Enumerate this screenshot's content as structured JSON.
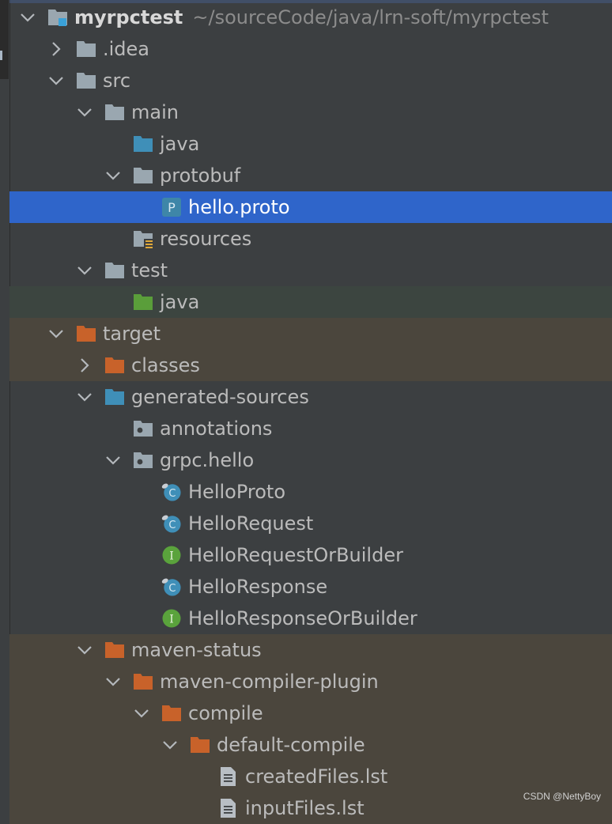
{
  "tree": [
    {
      "label": "myrpctest",
      "hint": "~/sourceCode/java/lrn-soft/myrpctest",
      "depth": 0,
      "arrow": "down",
      "icon": "module-folder-icon",
      "bold": true
    },
    {
      "label": ".idea",
      "depth": 1,
      "arrow": "right",
      "icon": "folder-icon"
    },
    {
      "label": "src",
      "depth": 1,
      "arrow": "down",
      "icon": "folder-icon"
    },
    {
      "label": "main",
      "depth": 2,
      "arrow": "down",
      "icon": "folder-icon"
    },
    {
      "label": "java",
      "depth": 3,
      "arrow": "none",
      "icon": "source-folder-icon"
    },
    {
      "label": "protobuf",
      "depth": 3,
      "arrow": "down",
      "icon": "folder-icon"
    },
    {
      "label": "hello.proto",
      "depth": 4,
      "arrow": "none",
      "icon": "proto-file-icon",
      "selected": true
    },
    {
      "label": "resources",
      "depth": 3,
      "arrow": "none",
      "icon": "resources-folder-icon"
    },
    {
      "label": "test",
      "depth": 2,
      "arrow": "down",
      "icon": "folder-icon"
    },
    {
      "label": "java",
      "depth": 3,
      "arrow": "none",
      "icon": "test-folder-icon",
      "bg": "grn"
    },
    {
      "label": "target",
      "depth": 1,
      "arrow": "down",
      "icon": "excluded-folder-icon",
      "bg": "brn"
    },
    {
      "label": "classes",
      "depth": 2,
      "arrow": "right",
      "icon": "excluded-folder-icon",
      "bg": "brn"
    },
    {
      "label": "generated-sources",
      "depth": 2,
      "arrow": "down",
      "icon": "generated-folder-icon"
    },
    {
      "label": "annotations",
      "depth": 3,
      "arrow": "none",
      "icon": "package-icon"
    },
    {
      "label": "grpc.hello",
      "depth": 3,
      "arrow": "down",
      "icon": "package-icon"
    },
    {
      "label": "HelloProto",
      "depth": 4,
      "arrow": "none",
      "icon": "class-icon"
    },
    {
      "label": "HelloRequest",
      "depth": 4,
      "arrow": "none",
      "icon": "class-icon"
    },
    {
      "label": "HelloRequestOrBuilder",
      "depth": 4,
      "arrow": "none",
      "icon": "interface-icon"
    },
    {
      "label": "HelloResponse",
      "depth": 4,
      "arrow": "none",
      "icon": "class-icon"
    },
    {
      "label": "HelloResponseOrBuilder",
      "depth": 4,
      "arrow": "none",
      "icon": "interface-icon"
    },
    {
      "label": "maven-status",
      "depth": 2,
      "arrow": "down",
      "icon": "excluded-folder-icon",
      "bg": "brn"
    },
    {
      "label": "maven-compiler-plugin",
      "depth": 3,
      "arrow": "down",
      "icon": "excluded-folder-icon",
      "bg": "brn"
    },
    {
      "label": "compile",
      "depth": 4,
      "arrow": "down",
      "icon": "excluded-folder-icon",
      "bg": "brn"
    },
    {
      "label": "default-compile",
      "depth": 5,
      "arrow": "down",
      "icon": "excluded-folder-icon",
      "bg": "brn"
    },
    {
      "label": "createdFiles.lst",
      "depth": 6,
      "arrow": "none",
      "icon": "text-file-icon",
      "bg": "brn"
    },
    {
      "label": "inputFiles.lst",
      "depth": 6,
      "arrow": "none",
      "icon": "text-file-icon",
      "bg": "brn"
    }
  ],
  "watermark": "CSDN @NettyBoy",
  "colors": {
    "selection": "#2f65ca",
    "folder": "#9aa7b0",
    "source": "#3f8fb8",
    "test": "#5a9e3a",
    "excluded": "#c8622a",
    "class": "#3f8fb8",
    "interface": "#5aa33c"
  }
}
